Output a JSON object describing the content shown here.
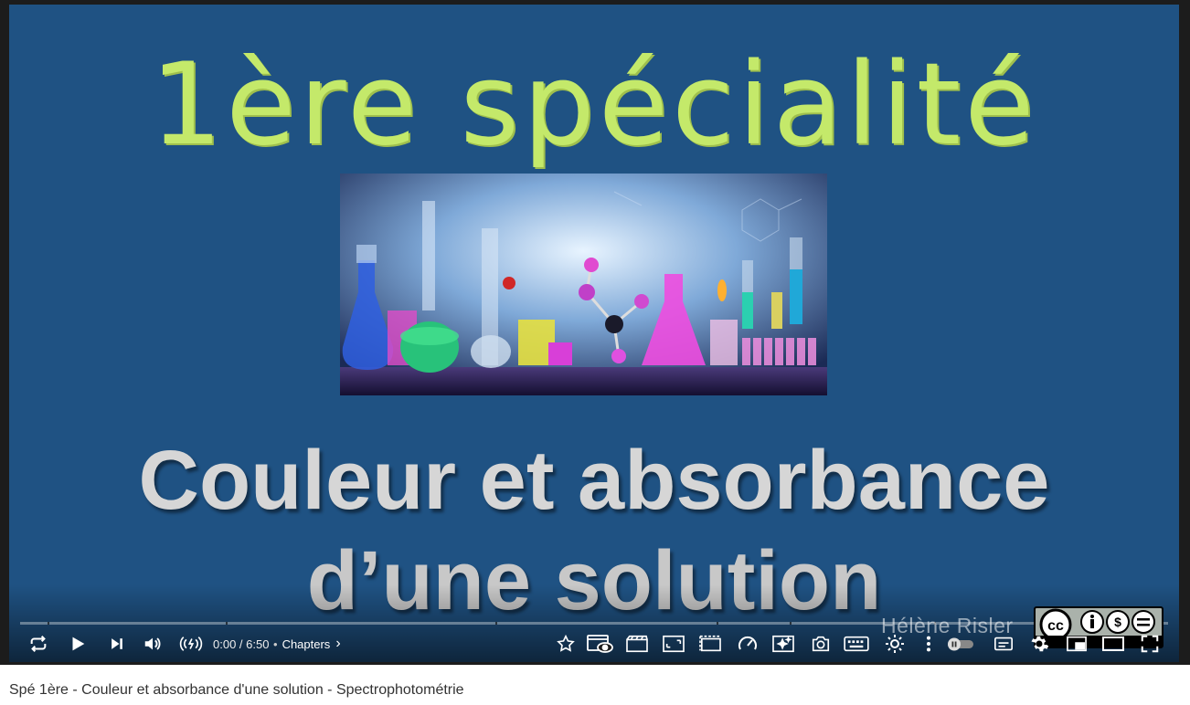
{
  "video": {
    "heading": "1ère spécialité",
    "subtitle_line1": "Couleur et absorbance",
    "subtitle_line2": "d’une solution",
    "watermark": "Hélène Risler"
  },
  "controls": {
    "time": "0:00 / 6:50",
    "chapters_label": "Chapters",
    "icons": [
      "loop-icon",
      "play-icon",
      "next-icon",
      "volume-icon",
      "autoplay-icon",
      "star-icon",
      "watch-icon",
      "clip-icon",
      "frame-icon",
      "theater-icon",
      "speed-icon",
      "sparkle-icon",
      "screenshot-icon",
      "keyboard-icon",
      "gear-sun-icon",
      "more-icon",
      "autoplay-toggle",
      "subtitles-icon",
      "settings-icon",
      "miniplayer-icon",
      "theater-mode-icon",
      "fullscreen-icon"
    ]
  },
  "page": {
    "title": "Spé 1ère - Couleur et absorbance d'une solution - Spectrophotométrie"
  },
  "colors": {
    "video_bg": "#1f5283",
    "heading": "#c4e96a",
    "subtitle": "#d6d6d6"
  }
}
